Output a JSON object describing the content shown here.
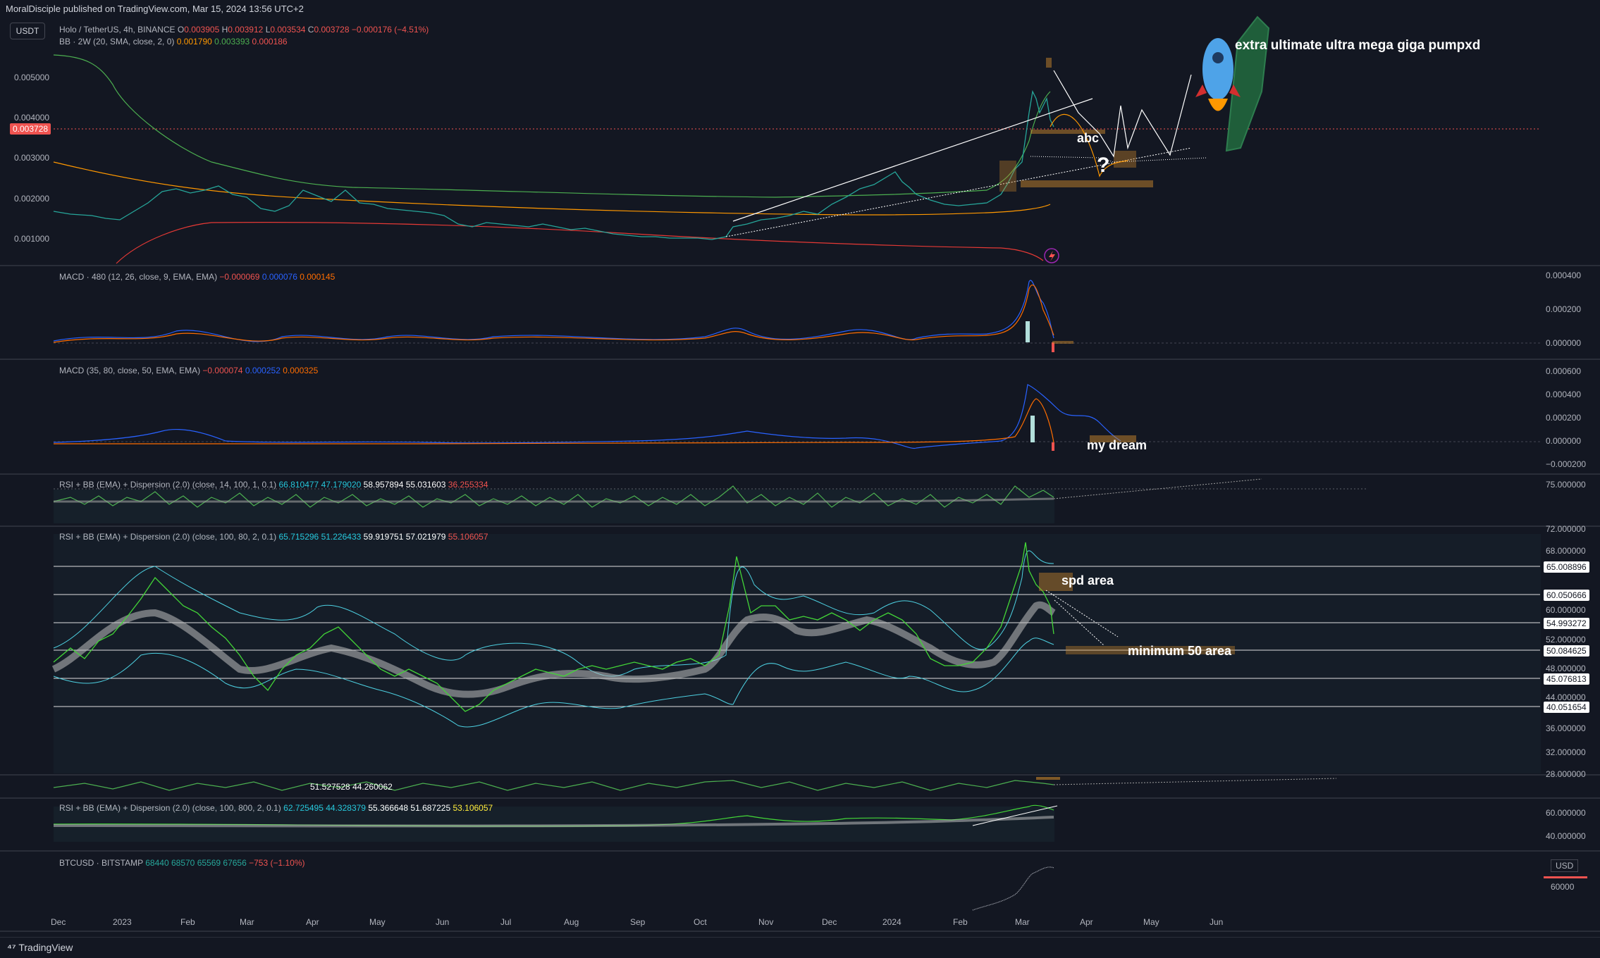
{
  "header": {
    "published_text": "MoralDisciple published on TradingView.com, Mar 15, 2024 13:56 UTC+2"
  },
  "chip_label": "USDT",
  "main_pane": {
    "symbol_line": "Holo / TetherUS, 4h, BINANCE",
    "o_label": "O",
    "o_value": "0.003905",
    "h_label": "H",
    "h_value": "0.003912",
    "l_label": "L",
    "l_value": "0.003534",
    "c_label": "C",
    "c_value": "0.003728",
    "change": "−0.000176 (−4.51%)",
    "bb_line": "BB · 2W (20, SMA, close, 2, 0)",
    "bb_v1": "0.001790",
    "bb_v2": "0.003393",
    "bb_v3": "0.000186",
    "y_ticks": [
      "0.005000",
      "0.004000",
      "0.003000",
      "0.002000",
      "0.001000"
    ],
    "current_price": "0.003728",
    "annotations": {
      "pump": "extra ultimate ultra mega giga pumpxd",
      "abc": "abc",
      "question": "?"
    }
  },
  "macd1": {
    "label": "MACD · 480 (12, 26, close, 9, EMA, EMA)",
    "v1": "−0.000069",
    "v2": "0.000076",
    "v3": "0.000145",
    "y_ticks": [
      "0.000400",
      "0.000200",
      "0.000000"
    ]
  },
  "macd2": {
    "label": "MACD (35, 80, close, 50, EMA, EMA)",
    "v1": "−0.000074",
    "v2": "0.000252",
    "v3": "0.000325",
    "y_ticks": [
      "0.000600",
      "0.000400",
      "0.000200",
      "0.000000",
      "−0.000200"
    ],
    "annotation": "my dream"
  },
  "rsi1": {
    "label": "RSI + BB (EMA) + Dispersion (2.0) (close, 14, 100, 1, 0.1)",
    "v1": "66.810477",
    "v2": "47.179020",
    "v3": "58.957894",
    "v4": "55.031603",
    "v5": "36.255334",
    "y_ticks": [
      "75.000000"
    ]
  },
  "rsi2": {
    "label": "RSI + BB (EMA) + Dispersion (2.0) (close, 100, 80, 2, 0.1)",
    "v1": "65.715296",
    "v2": "51.226433",
    "v3": "59.919751",
    "v4": "57.021979",
    "v5": "55.106057",
    "y_ticks": [
      "72.000000",
      "68.000000",
      "64.000000",
      "60.000000",
      "56.000000",
      "52.000000",
      "48.000000",
      "44.000000",
      "40.000000",
      "36.000000",
      "32.000000",
      "28.000000"
    ],
    "level_tags": [
      "65.008896",
      "60.050666",
      "54.993272",
      "50.084625",
      "45.076813",
      "40.051654"
    ],
    "annotations": {
      "spd": "spd area",
      "min50": "minimum 50 area"
    }
  },
  "rsi3": {
    "v1": "51.527528",
    "v2": "44.260062"
  },
  "rsi4": {
    "label": "RSI + BB (EMA) + Dispersion (2.0) (close, 100, 800, 2, 0.1)",
    "v1": "62.725495",
    "v2": "44.328379",
    "v3": "55.366648",
    "v4": "51.687225",
    "v5": "53.106057",
    "y_ticks": [
      "60.000000",
      "40.000000"
    ]
  },
  "btc": {
    "label": "BTCUSD · BITSTAMP",
    "v1": "68440",
    "v2": "68570",
    "v3": "65569",
    "v4": "67656",
    "change": "−753 (−1.10%)",
    "y_ticks": [
      "60000"
    ],
    "currency": "USD"
  },
  "time_axis": [
    "Dec",
    "2023",
    "Feb",
    "Mar",
    "Apr",
    "May",
    "Jun",
    "Jul",
    "Aug",
    "Sep",
    "Oct",
    "Nov",
    "Dec",
    "2024",
    "Feb",
    "Mar",
    "Apr",
    "May",
    "Jun"
  ],
  "footer": {
    "logo": "TradingView"
  },
  "colors": {
    "bg": "#131722",
    "up": "#26a69a",
    "down": "#ef5350",
    "blue": "#2962ff",
    "orange": "#ff6d00"
  }
}
